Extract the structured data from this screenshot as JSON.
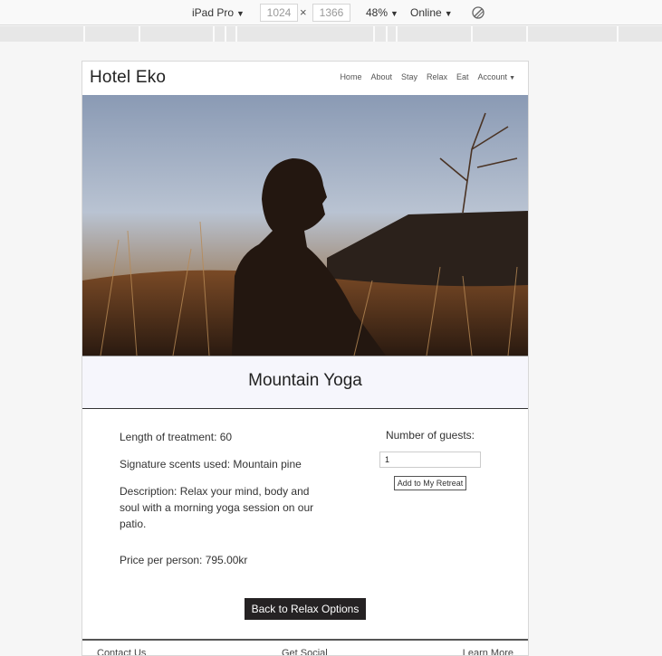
{
  "devtools": {
    "device": "iPad Pro",
    "width": "1024",
    "separator": "×",
    "height": "1366",
    "zoom": "48%",
    "network": "Online",
    "icons": {
      "caret": "caret-down-icon",
      "rotate": "rotate-icon"
    }
  },
  "site": {
    "brand": "Hotel Eko",
    "nav": [
      "Home",
      "About",
      "Stay",
      "Relax",
      "Eat",
      "Account"
    ]
  },
  "hero": {
    "image": "man-meditating-in-field-photo"
  },
  "treatment": {
    "title": "Mountain Yoga",
    "length": "Length of treatment: 60",
    "scents": "Signature scents used: Mountain pine",
    "description": "Description: Relax your mind, body and soul with a morning yoga session on our patio.",
    "price": "Price per person: 795.00kr"
  },
  "booking": {
    "guests_label": "Number of guests:",
    "guests_value": "1",
    "add_label": "Add to My Retreat"
  },
  "back_label": "Back to Relax Options",
  "footer": {
    "left": "Contact Us",
    "center": "Get Social",
    "right": "Learn More"
  }
}
